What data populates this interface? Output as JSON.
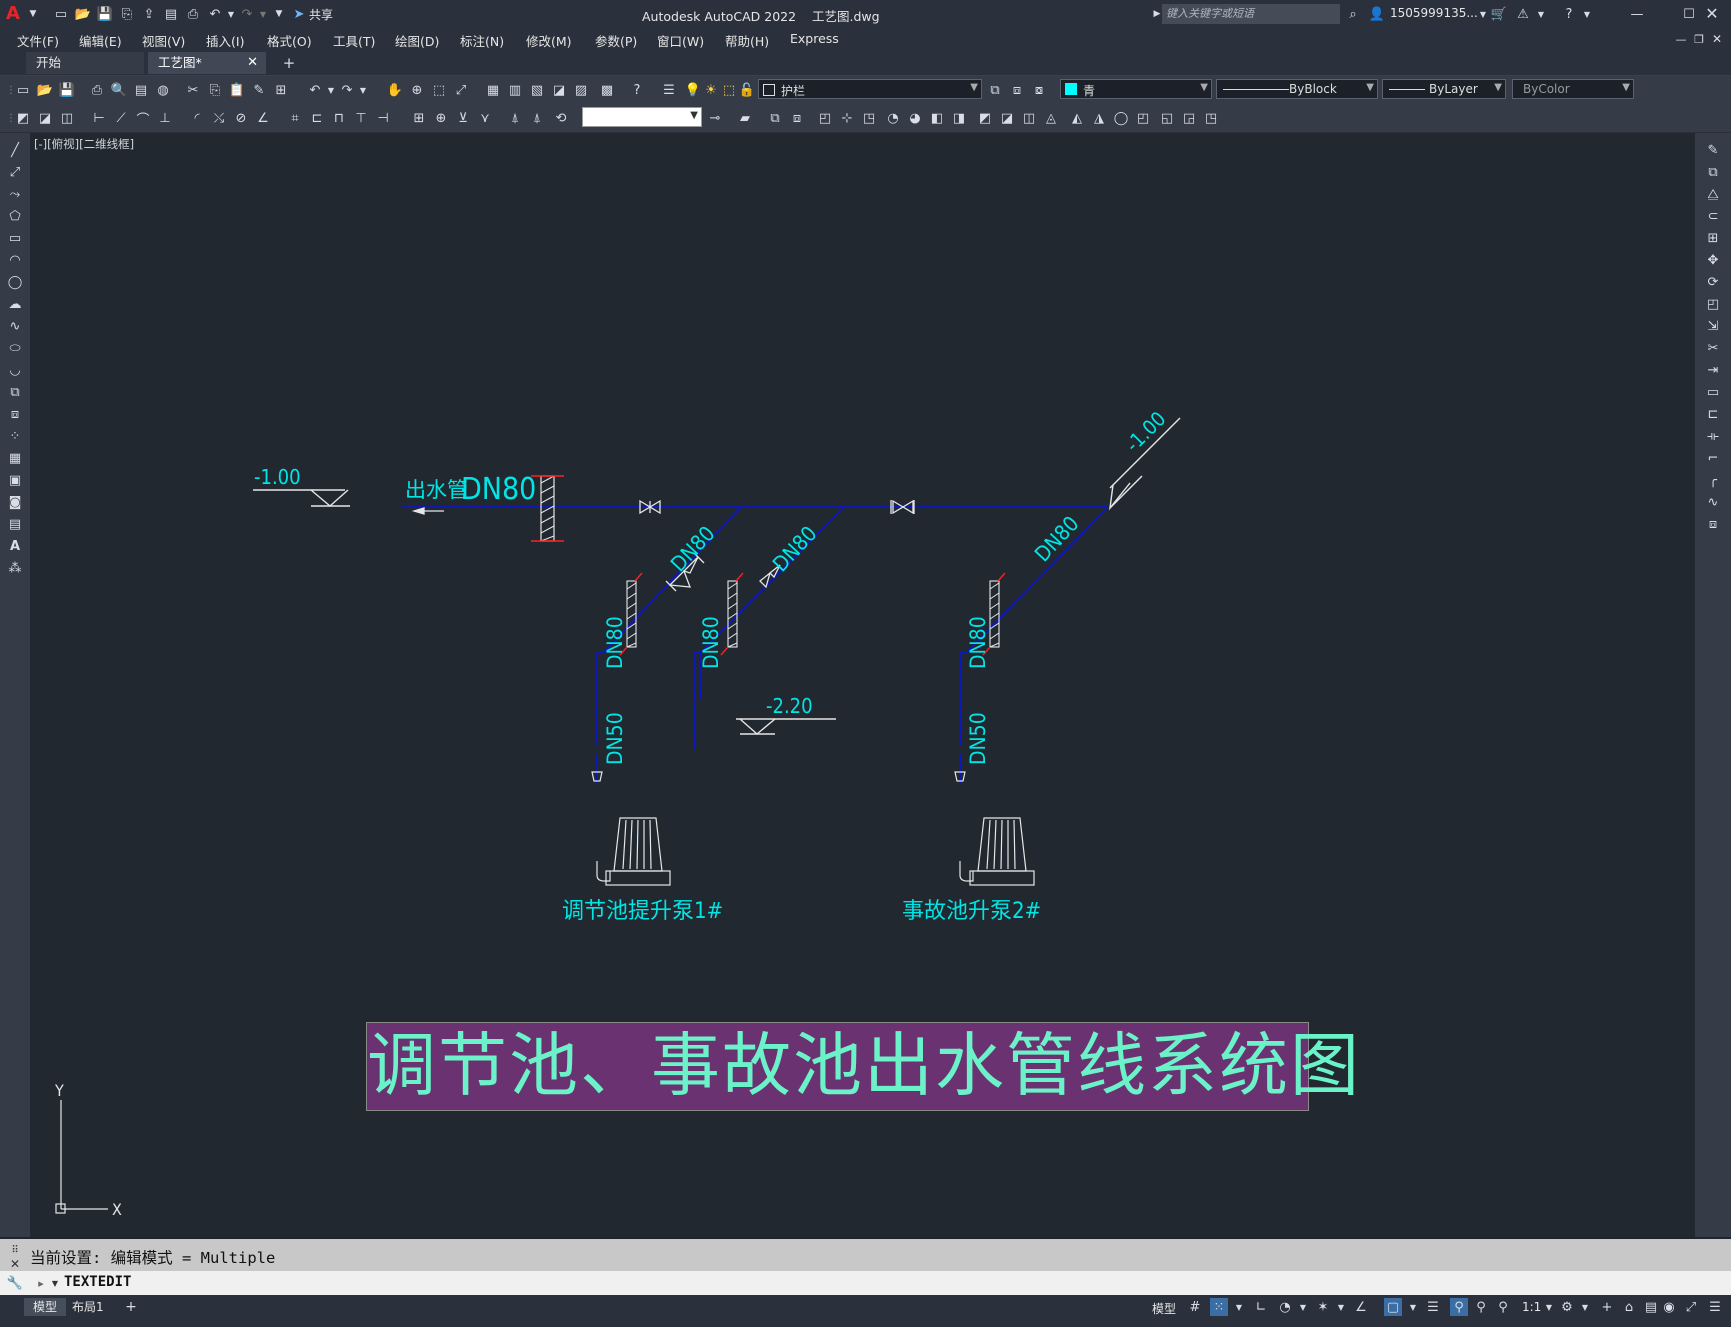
{
  "app": {
    "title": "Autodesk AutoCAD 2022    工艺图.dwg",
    "share_label": "共享",
    "search_placeholder": "键入关键字或短语",
    "user": "1505999135..."
  },
  "menu": [
    "文件(F)",
    "编辑(E)",
    "视图(V)",
    "插入(I)",
    "格式(O)",
    "工具(T)",
    "绘图(D)",
    "标注(N)",
    "修改(M)",
    "参数(P)",
    "窗口(W)",
    "帮助(H)",
    "Express"
  ],
  "tabs": [
    {
      "label": "开始"
    },
    {
      "label": "工艺图*"
    }
  ],
  "layer": {
    "name": "护栏"
  },
  "color": {
    "name": "青",
    "swatch": "#00ffff"
  },
  "linetype": "ByBlock",
  "lineweight": "ByLayer",
  "plotstyle": "ByColor",
  "viewport_label": "[-][俯视][二维线框]",
  "drawing": {
    "level_left": "-1.00",
    "outlet_label": "出水管",
    "outlet_dn": "DN80",
    "dn80_a": "DN80",
    "dn80_b": "DN80",
    "dn80_c": "DN80",
    "dn80_v1": "DN80",
    "dn80_v2": "DN80",
    "dn80_v3": "DN80",
    "dn50_1": "DN50",
    "dn50_2": "DN50",
    "level_right": "-1.00",
    "level_mid": "-2.20",
    "pump1": "调节池提升泵1#",
    "pump2": "事故池升泵2#",
    "title": "调节池、事故池出水管线系统图",
    "colors": {
      "pipe": "#0000cc",
      "text": "#00e5e5",
      "cut": "#ff2020",
      "title_bg": "#6b3272",
      "title_fg": "#6cf2c8"
    }
  },
  "ucs": {
    "x": "X",
    "y": "Y"
  },
  "command": {
    "history": "当前设置: 编辑模式 = Multiple",
    "current": "TEXTEDIT"
  },
  "layout_tabs": [
    "模型",
    "布局1"
  ],
  "status": {
    "model": "模型",
    "scale": "1:1"
  }
}
